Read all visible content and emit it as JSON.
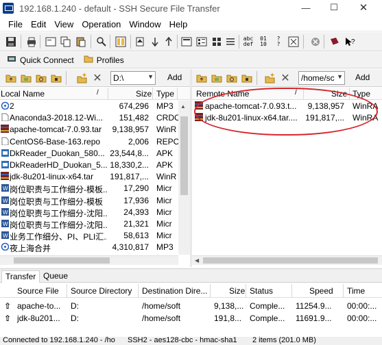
{
  "window": {
    "title": "192.168.1.240 - default - SSH Secure File Transfer",
    "minimize_icon": "minimize-icon",
    "maximize_icon": "maximize-icon",
    "close_icon": "close-icon"
  },
  "menu": {
    "file": "File",
    "edit": "Edit",
    "view": "View",
    "operation": "Operation",
    "window": "Window",
    "help": "Help"
  },
  "toolbar2": {
    "quick_connect": "Quick Connect",
    "profiles": "Profiles"
  },
  "local": {
    "path": "D:\\",
    "add_label": "Add",
    "columns": {
      "name": "Local Name",
      "size": "Size",
      "type": "Type"
    },
    "files": [
      {
        "name": "2",
        "size": "674,296",
        "type": "MP3"
      },
      {
        "name": "Anaconda3-2018.12-Wi...",
        "size": "151,482",
        "type": "CRDC"
      },
      {
        "name": "apache-tomcat-7.0.93.tar",
        "size": "9,138,957",
        "type": "WinR"
      },
      {
        "name": "CentOS6-Base-163.repo",
        "size": "2,006",
        "type": "REPO"
      },
      {
        "name": "DkReader_Duokan_580...",
        "size": "23,544,8...",
        "type": "APK"
      },
      {
        "name": "DkReaderHD_Duokan_5...",
        "size": "18,330,2...",
        "type": "APK"
      },
      {
        "name": "jdk-8u201-linux-x64.tar",
        "size": "191,817,...",
        "type": "WinR"
      },
      {
        "name": "岗位职责与工作细分-模板...",
        "size": "17,290",
        "type": "Micr"
      },
      {
        "name": "岗位职责与工作细分-模板",
        "size": "17,936",
        "type": "Micr"
      },
      {
        "name": "岗位职责与工作细分-沈阳...",
        "size": "24,393",
        "type": "Micr"
      },
      {
        "name": "岗位职责与工作细分-沈阳...",
        "size": "21,321",
        "type": "Micr"
      },
      {
        "name": "业务工作细分、PI、PLI汇...",
        "size": "58,613",
        "type": "Micr"
      },
      {
        "name": "夜上海合并",
        "size": "4,310,817",
        "type": "MP3"
      }
    ]
  },
  "remote": {
    "path": "/home/sc",
    "add_label": "Add",
    "columns": {
      "name": "Remote Name",
      "size": "Size",
      "type": "Type"
    },
    "files": [
      {
        "name": "apache-tomcat-7.0.93.t...",
        "size": "9,138,957",
        "type": "WinRA"
      },
      {
        "name": "jdk-8u201-linux-x64.tar....",
        "size": "191,817,...",
        "type": "WinRA"
      }
    ]
  },
  "transfer": {
    "tabs": [
      "Transfer",
      "Queue"
    ],
    "columns": {
      "source_file": "Source File",
      "source_dir": "Source Directory",
      "dest_dir": "Destination Dire...",
      "size": "Size",
      "status": "Status",
      "speed": "Speed",
      "time": "Time"
    },
    "rows": [
      {
        "file": "apache-to...",
        "src": "D:",
        "dest": "/home/soft",
        "size": "9,138,...",
        "status": "Comple...",
        "speed": "11254.9...",
        "time": "00:00:..."
      },
      {
        "file": "jdk-8u201...",
        "src": "D:",
        "dest": "/home/soft",
        "size": "191,8...",
        "status": "Comple...",
        "speed": "11691.9...",
        "time": "00:00:..."
      }
    ]
  },
  "status": {
    "connection": "Connected to 192.168.1.240 - /ho",
    "cipher": "SSH2 - aes128-cbc - hmac-sha1",
    "items": "2 items (201.0 MB)"
  },
  "colors": {
    "highlight": "#d4262c",
    "folder": "#e8b84a",
    "winrar": "#7a1f1f"
  }
}
